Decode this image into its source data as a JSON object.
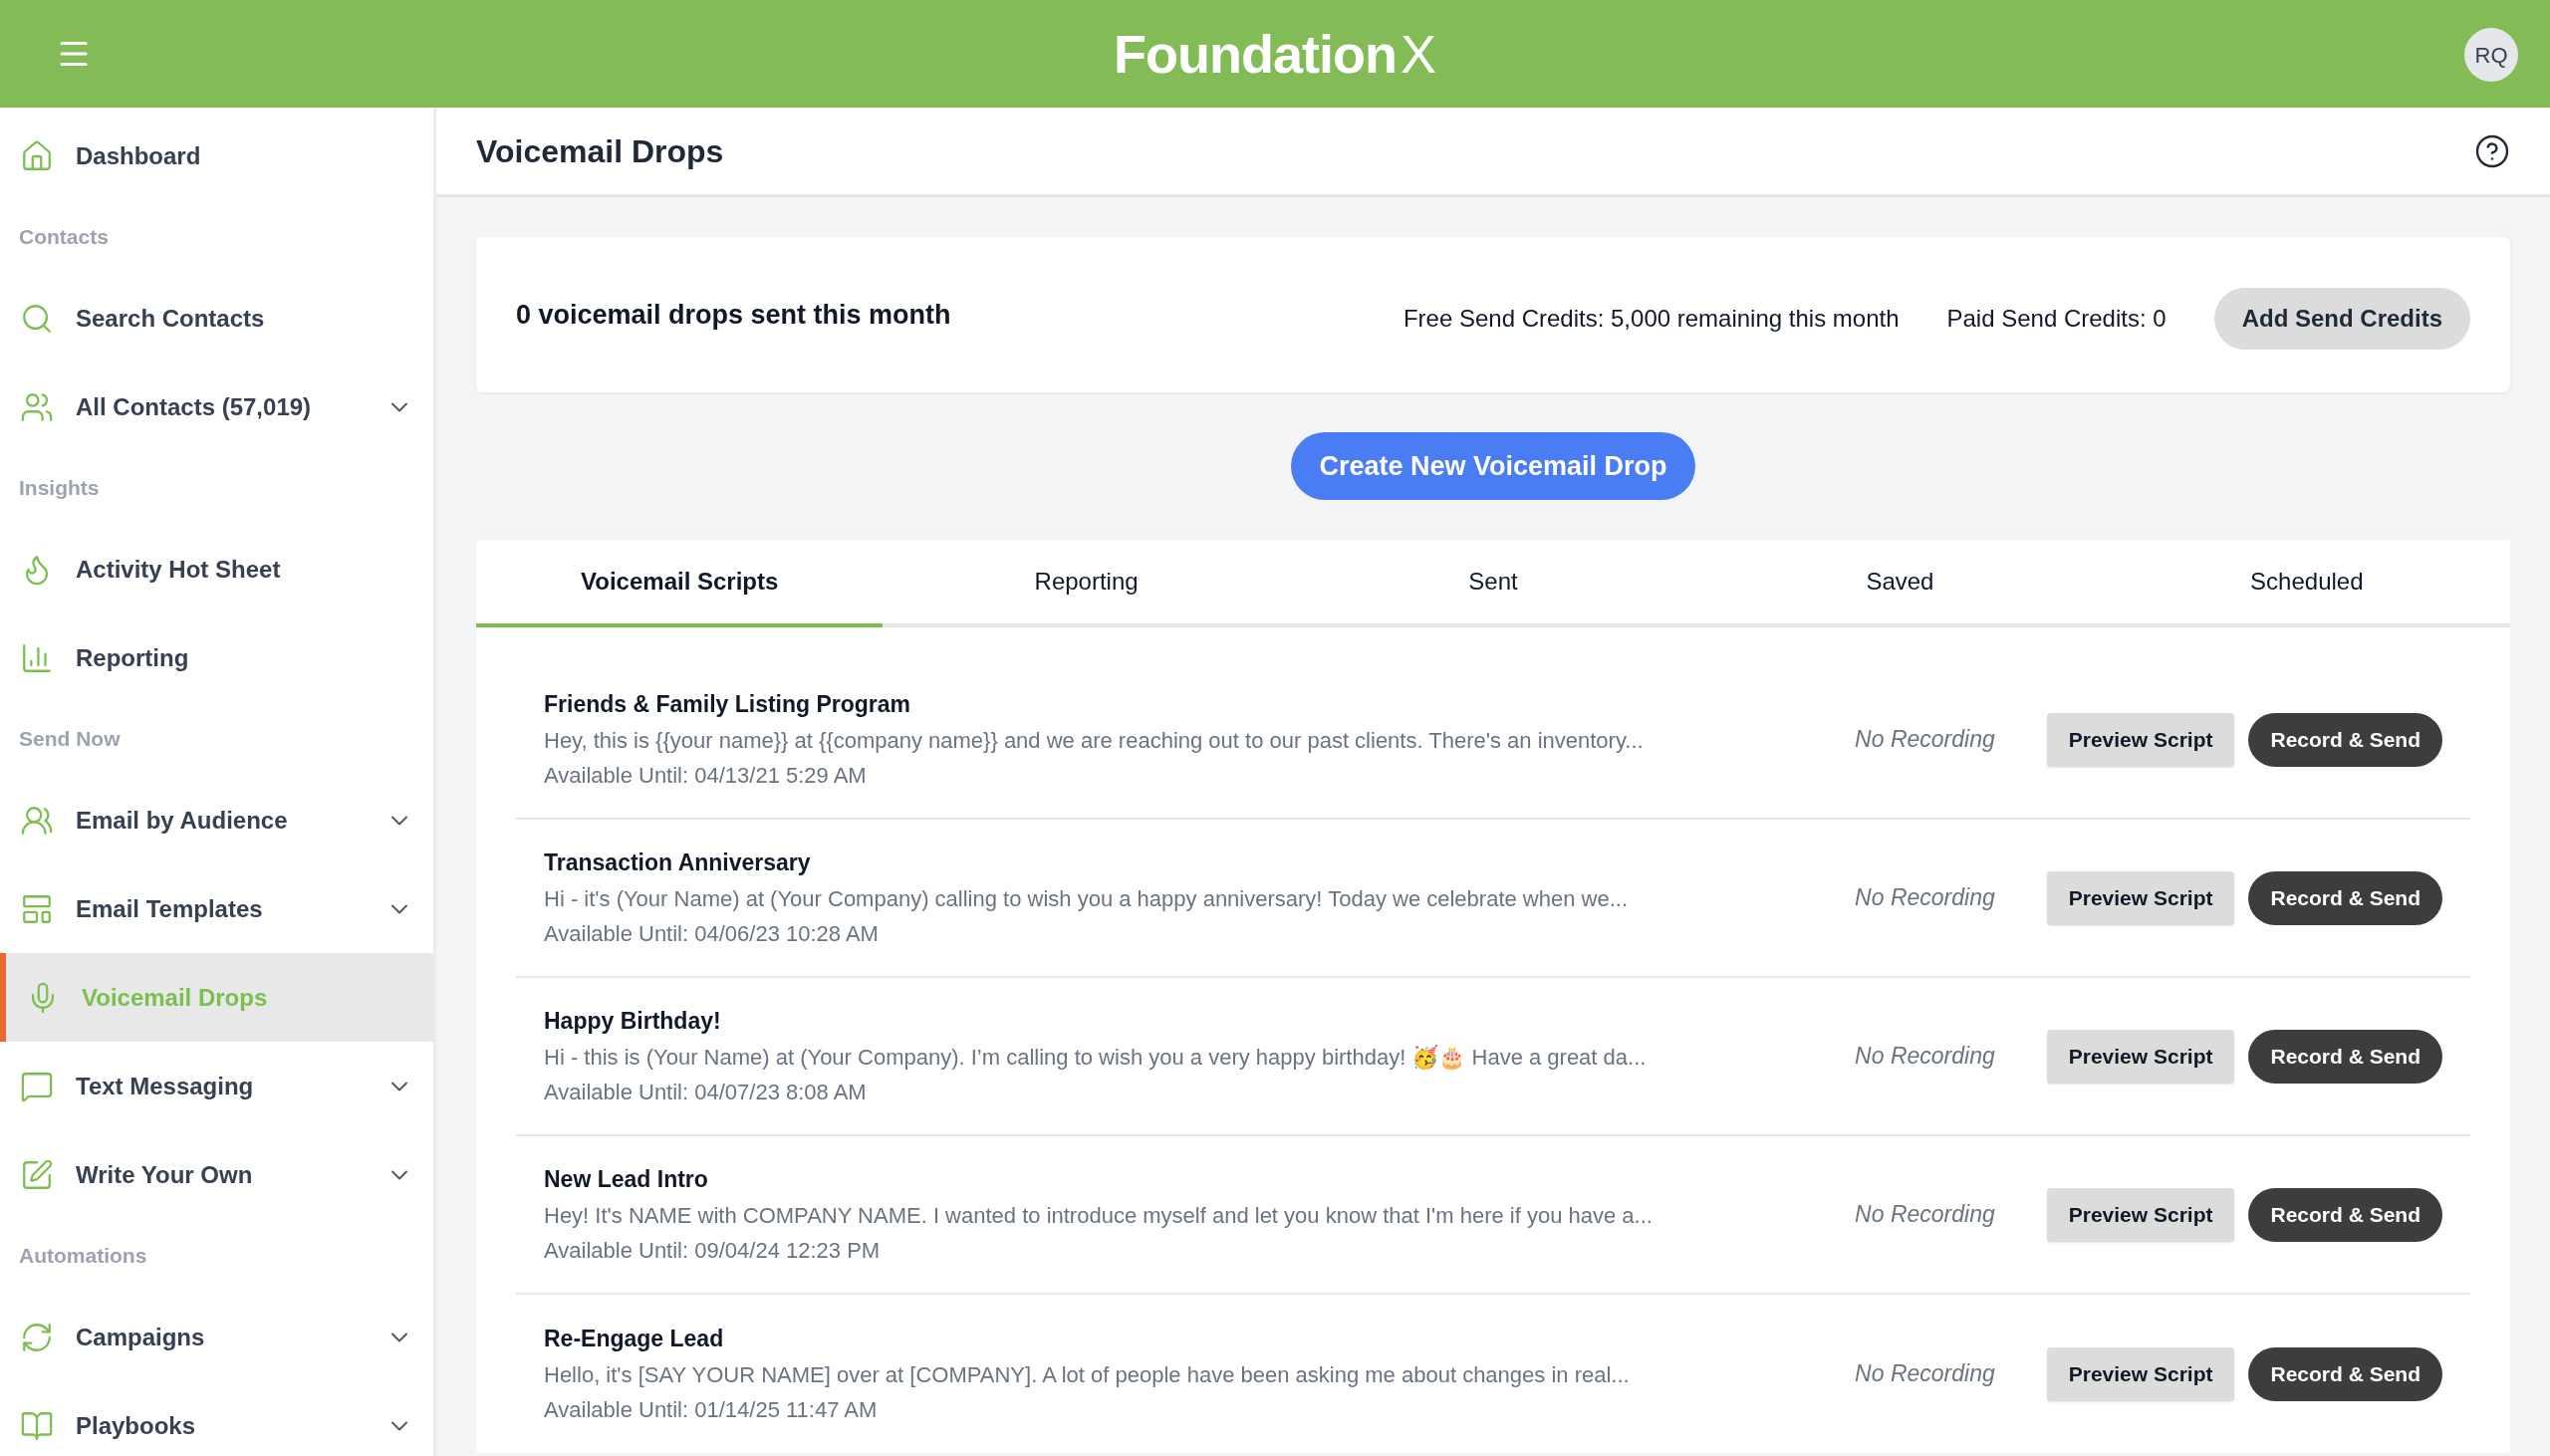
{
  "header": {
    "logo_name": "Foundation",
    "logo_mark": "X",
    "avatar": "RQ"
  },
  "sidebar": {
    "items": [
      {
        "kind": "link",
        "label": "Dashboard",
        "selected": false
      },
      {
        "kind": "section",
        "label": "Contacts"
      },
      {
        "kind": "link",
        "label": "Search Contacts",
        "selected": false
      },
      {
        "kind": "link",
        "label": "All Contacts (57,019)",
        "selected": false,
        "expanded": false
      },
      {
        "kind": "section",
        "label": "Insights"
      },
      {
        "kind": "link",
        "label": "Activity Hot Sheet",
        "selected": false
      },
      {
        "kind": "link",
        "label": "Reporting",
        "selected": false
      },
      {
        "kind": "section",
        "label": "Send Now"
      },
      {
        "kind": "link",
        "label": "Email by Audience",
        "selected": false,
        "expanded": false
      },
      {
        "kind": "link",
        "label": "Email Templates",
        "selected": false,
        "expanded": false
      },
      {
        "kind": "link",
        "label": "Voicemail Drops",
        "selected": true
      },
      {
        "kind": "link",
        "label": "Text Messaging",
        "selected": false,
        "expanded": false
      },
      {
        "kind": "link",
        "label": "Write Your Own",
        "selected": false,
        "expanded": false
      },
      {
        "kind": "section",
        "label": "Automations"
      },
      {
        "kind": "link",
        "label": "Campaigns",
        "selected": false,
        "expanded": false
      },
      {
        "kind": "link",
        "label": "Playbooks",
        "selected": false,
        "expanded": false
      }
    ]
  },
  "page": {
    "title": "Voicemail Drops"
  },
  "summary": {
    "sent": "0 voicemail drops sent this month",
    "free_credits": "Free Send Credits: 5,000 remaining this month",
    "paid_credits": "Paid Send Credits: 0",
    "add_button": "Add Send Credits"
  },
  "create_button": "Create New Voicemail Drop",
  "tabs": [
    {
      "label": "Voicemail Scripts",
      "selected": true
    },
    {
      "label": "Reporting",
      "selected": false
    },
    {
      "label": "Sent",
      "selected": false
    },
    {
      "label": "Saved",
      "selected": false
    },
    {
      "label": "Scheduled",
      "selected": false
    }
  ],
  "scripts": [
    {
      "title": "Friends & Family Listing Program",
      "description": "Hey, this is {{your name}} at {{company name}} and we are reaching out to our past clients. There's an inventory...",
      "available": "Available Until: 04/13/21 5:29 AM",
      "recording": "No Recording",
      "preview_button": "Preview Script",
      "record_button": "Record & Send"
    },
    {
      "title": "Transaction Anniversary",
      "description": "Hi - it's (Your Name) at (Your Company) calling to wish you a happy anniversary! Today we celebrate when we...",
      "available": "Available Until: 04/06/23 10:28 AM",
      "recording": "No Recording",
      "preview_button": "Preview Script",
      "record_button": "Record & Send"
    },
    {
      "title": "Happy Birthday!",
      "description": "Hi - this is (Your Name) at (Your Company). I’m calling to wish you a very happy birthday! 🥳🎂 Have a great da...",
      "available": "Available Until: 04/07/23 8:08 AM",
      "recording": "No Recording",
      "preview_button": "Preview Script",
      "record_button": "Record & Send"
    },
    {
      "title": "New Lead Intro",
      "description": "Hey! It's NAME with COMPANY NAME. I wanted to introduce myself and let you know that I'm here if you have a...",
      "available": "Available Until: 09/04/24 12:23 PM",
      "recording": "No Recording",
      "preview_button": "Preview Script",
      "record_button": "Record & Send"
    },
    {
      "title": "Re-Engage Lead",
      "description": "Hello, it's [SAY YOUR NAME] over at [COMPANY]. A lot of people have been asking me about changes in real...",
      "available": "Available Until: 01/14/25 11:47 AM",
      "recording": "No Recording",
      "preview_button": "Preview Script",
      "record_button": "Record & Send"
    }
  ]
}
